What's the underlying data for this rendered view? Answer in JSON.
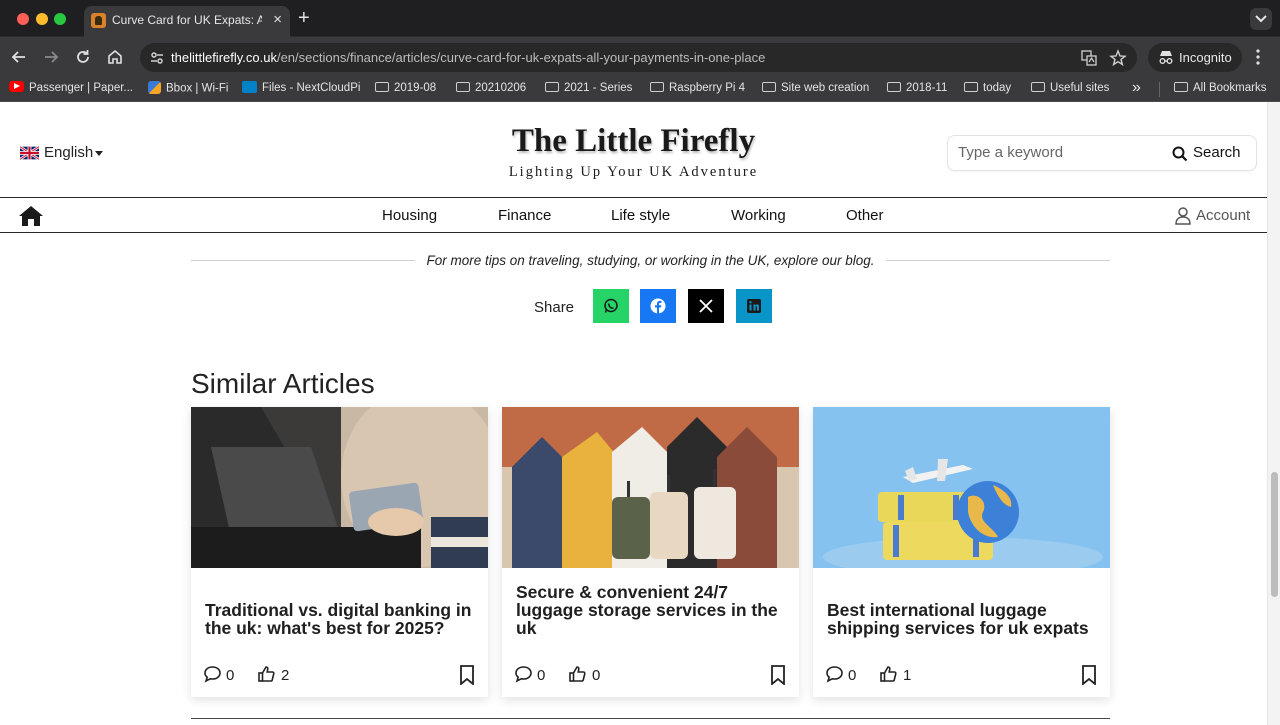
{
  "browser": {
    "tab_title": "Curve Card for UK Expats: All",
    "url_host": "thelittlefirefly.co.uk",
    "url_path": "/en/sections/finance/articles/curve-card-for-uk-expats-all-your-payments-in-one-place",
    "incognito_label": "Incognito",
    "bookmarks": [
      {
        "label": "Passenger | Paper...",
        "icon": "youtube-icon"
      },
      {
        "label": "Bbox | Wi-Fi",
        "icon": "bbox-icon"
      },
      {
        "label": "Files - NextCloudPi",
        "icon": "nextcloud-icon"
      },
      {
        "label": "2019-08",
        "icon": "folder-icon"
      },
      {
        "label": "20210206",
        "icon": "folder-icon"
      },
      {
        "label": "2021 - Series",
        "icon": "folder-icon"
      },
      {
        "label": "Raspberry Pi 4",
        "icon": "folder-icon"
      },
      {
        "label": "Site web creation",
        "icon": "folder-icon"
      },
      {
        "label": "2018-11",
        "icon": "folder-icon"
      },
      {
        "label": "today",
        "icon": "folder-icon"
      },
      {
        "label": "Useful sites",
        "icon": "folder-icon"
      }
    ],
    "overflow_label": "»",
    "all_bookmarks_label": "All Bookmarks"
  },
  "site": {
    "language": "English",
    "logo": "The Little Firefly",
    "tagline": "Lighting Up Your UK Adventure",
    "search_placeholder": "Type a keyword",
    "search_button": "Search",
    "nav": [
      "Housing",
      "Finance",
      "Life style",
      "Working",
      "Other"
    ],
    "account_label": "Account"
  },
  "article": {
    "tips_text": "For more tips on traveling, studying, or working in the UK, explore our blog.",
    "share_label": "Share",
    "share_buttons": [
      {
        "name": "whatsapp",
        "color": "#25d366"
      },
      {
        "name": "facebook",
        "color": "#1877f2"
      },
      {
        "name": "x",
        "color": "#000000"
      },
      {
        "name": "linkedin",
        "color": "#0a95c9"
      }
    ]
  },
  "similar": {
    "heading": "Similar Articles",
    "cards": [
      {
        "title": "Traditional vs. digital banking in the uk: what's best for 2025?",
        "comments": "0",
        "likes": "2"
      },
      {
        "title": "Secure & convenient 24/7 luggage storage services in the uk",
        "comments": "0",
        "likes": "0"
      },
      {
        "title": "Best international luggage shipping services for uk expats",
        "comments": "0",
        "likes": "1"
      }
    ]
  }
}
